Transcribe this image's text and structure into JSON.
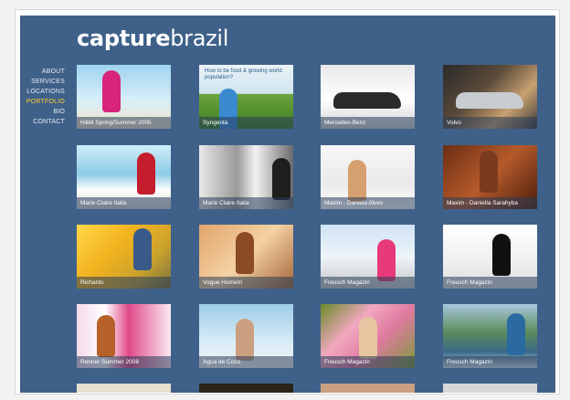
{
  "logo": {
    "part1": "capture",
    "part2": "brazil"
  },
  "nav": {
    "items": [
      {
        "label": "ABOUT",
        "active": false
      },
      {
        "label": "SERVICES",
        "active": false
      },
      {
        "label": "LOCATIONS",
        "active": false
      },
      {
        "label": "PORTFOLIO",
        "active": true
      },
      {
        "label": "BIO",
        "active": false
      },
      {
        "label": "CONTACT",
        "active": false
      }
    ]
  },
  "colors": {
    "background": "#3f6189",
    "nav_text": "#e6ecf3",
    "nav_active": "#ffcc33"
  },
  "portfolio": {
    "rows": [
      [
        {
          "caption": "H&M Spring/Summer 2005",
          "scene": "magenta-beach"
        },
        {
          "caption": "Syngenta",
          "scene": "field-banner",
          "banner_text": "How to be food & growing world population?"
        },
        {
          "caption": "Mercedes-Benz",
          "scene": "car-studio"
        },
        {
          "caption": "Volvo",
          "scene": "car-street"
        }
      ],
      [
        {
          "caption": "Marie Claire Italia",
          "scene": "sea-red-dress"
        },
        {
          "caption": "Marie Claire Italia",
          "scene": "bw-street"
        },
        {
          "caption": "Maxim - Daniela Alves",
          "scene": "lounging-white"
        },
        {
          "caption": "Maxim - Daniella Sarahyba",
          "scene": "portrait-warm"
        }
      ],
      [
        {
          "caption": "Richards",
          "scene": "golden-light"
        },
        {
          "caption": "Vogue Homem",
          "scene": "closeup-warm"
        },
        {
          "caption": "Freusch Magazin",
          "scene": "architecture-pink"
        },
        {
          "caption": "Freusch Magazin",
          "scene": "bw-black-dress"
        }
      ],
      [
        {
          "caption": "Renner Summer 2008",
          "scene": "magazine-covers"
        },
        {
          "caption": "Agua de Coco",
          "scene": "sky-bikini"
        },
        {
          "caption": "Freusch Magazin",
          "scene": "flowers"
        },
        {
          "caption": "Freusch Magazin",
          "scene": "coast-rail"
        }
      ]
    ]
  }
}
